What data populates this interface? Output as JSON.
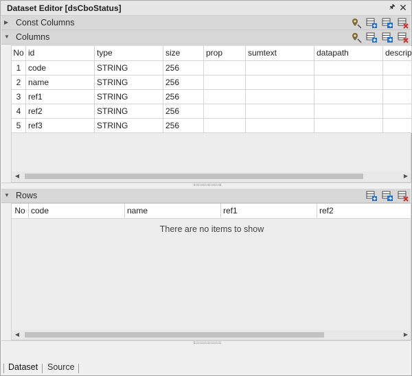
{
  "window": {
    "title": "Dataset Editor [dsCboStatus]",
    "pin_glyph": "🖈",
    "close_glyph": "✕"
  },
  "sections": {
    "const_columns": {
      "label": "Const Columns",
      "expanded": false
    },
    "columns": {
      "label": "Columns",
      "expanded": true
    },
    "rows": {
      "label": "Rows",
      "expanded": true
    }
  },
  "toolbar_icons": [
    "location-pin-icon",
    "add-column-icon",
    "edit-column-icon",
    "delete-column-icon"
  ],
  "columns_grid": {
    "headers": [
      "No",
      "id",
      "type",
      "size",
      "prop",
      "sumtext",
      "datapath",
      "descrip"
    ],
    "rows": [
      [
        "1",
        "code",
        "STRING",
        "256",
        "",
        "",
        "",
        ""
      ],
      [
        "2",
        "name",
        "STRING",
        "256",
        "",
        "",
        "",
        ""
      ],
      [
        "3",
        "ref1",
        "STRING",
        "256",
        "",
        "",
        "",
        ""
      ],
      [
        "4",
        "ref2",
        "STRING",
        "256",
        "",
        "",
        "",
        ""
      ],
      [
        "5",
        "ref3",
        "STRING",
        "256",
        "",
        "",
        "",
        ""
      ]
    ]
  },
  "rows_grid": {
    "headers": [
      "No",
      "code",
      "name",
      "ref1",
      "ref2"
    ],
    "empty_message": "There are no items to show"
  },
  "tabs": [
    {
      "label": "Dataset",
      "active": true
    },
    {
      "label": "Source",
      "active": false
    }
  ],
  "colors": {
    "header_bg": "#d8d8d8",
    "title_bg": "#e6e6e6",
    "grid_bg": "#ffffff",
    "panel_bg": "#ededed",
    "accent_blue": "#1f6fd0",
    "delete_red": "#d9342b"
  }
}
